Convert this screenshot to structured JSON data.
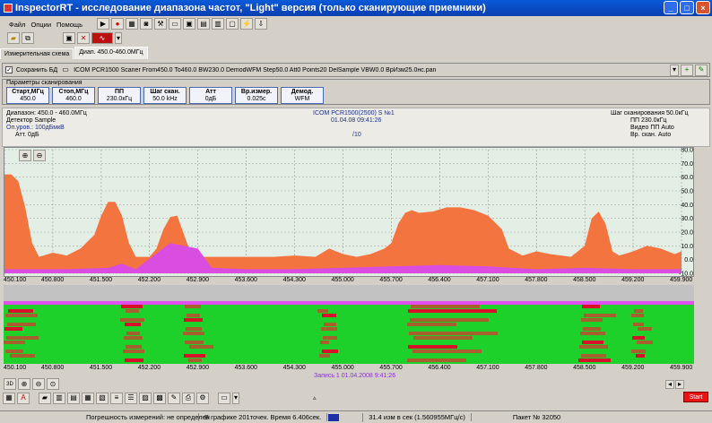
{
  "window": {
    "title": "InspectorRT - исследование диапазона частот, \"Light\" версия (только сканирующие приемники)"
  },
  "menu": [
    "Файл",
    "Опции",
    "Помощь"
  ],
  "tabs": [
    "Измерительная схема",
    "Диап. 450.0-460.0МГц"
  ],
  "scan": {
    "save_label": "Сохранить БД",
    "command": "ICOM PCR1500 Scaner From450.0 To460.0 BW230.0 DemodWFM Step50.0 Att0 Points20 DelSample VBW0.0 ВрИзм25.0нс.pan"
  },
  "params": {
    "title": "Параметры сканирования",
    "items": [
      {
        "label": "Старт,МГц",
        "value": "450.0"
      },
      {
        "label": "Стоп,МГц",
        "value": "460.0"
      },
      {
        "label": "ПП",
        "value": "230.0кГц"
      },
      {
        "label": "Шаг скан.",
        "value": "50.0 kHz"
      },
      {
        "label": "Атт",
        "value": "0дБ"
      },
      {
        "label": "Вр.измер.",
        "value": "0.025с"
      },
      {
        "label": "Демод.",
        "value": "WFM"
      }
    ]
  },
  "info": {
    "range": "Диапазон: 450.0 - 460.0МГц",
    "detector": "Детектор  Sample",
    "ref_level": "Оп.уров.: 100дБмкВ",
    "att": "Атт.  0дБ",
    "device": "ICOM PCR1500(2500) S №1",
    "datetime": "01.04.08 09:41:26",
    "scale": "/10",
    "step": "Шаг сканирования  50.0кГц",
    "bw": "ПП   230.0кГц",
    "video_bw": "Видео ПП  Auto",
    "scan_time": "Вр. скан.  Auto"
  },
  "chart_data": {
    "type": "area",
    "xlabel": "",
    "ylabel": "",
    "xlim": [
      450.1,
      459.9
    ],
    "ylim": [
      -10,
      80
    ],
    "x_ticks": [
      "450.100",
      "450.800",
      "451.500",
      "452.200",
      "452.900",
      "453.600",
      "454.300",
      "455.000",
      "455.700",
      "456.400",
      "457.100",
      "457.800",
      "458.500",
      "459.200",
      "459.900"
    ],
    "y_ticks": [
      "80.0",
      "70.0",
      "60.0",
      "50.0",
      "40.0",
      "30.0",
      "20.0",
      "10.0",
      "0.0",
      "-10.0"
    ],
    "series": [
      {
        "color": "#f4743f",
        "x": [
          450.1,
          450.2,
          450.3,
          450.4,
          450.5,
          450.6,
          450.8,
          451.0,
          451.2,
          451.4,
          451.5,
          451.6,
          451.7,
          451.8,
          451.9,
          452.0,
          452.2,
          452.3,
          452.4,
          452.5,
          452.6,
          452.7,
          452.8,
          452.9,
          453.0,
          453.2,
          453.6,
          454.0,
          454.3,
          454.6,
          454.8,
          455.0,
          455.2,
          455.4,
          455.6,
          455.7,
          455.8,
          455.9,
          456.0,
          456.1,
          456.3,
          456.5,
          456.7,
          456.9,
          457.1,
          457.3,
          457.4,
          457.6,
          457.8,
          458.0,
          458.3,
          458.5,
          458.6,
          458.7,
          458.8,
          458.9,
          459.0,
          459.2,
          459.4,
          459.6,
          459.8,
          459.9
        ],
        "y": [
          62,
          62,
          57,
          38,
          12,
          2,
          5,
          3,
          8,
          18,
          32,
          42,
          42,
          32,
          12,
          2,
          2,
          8,
          22,
          31,
          32,
          18,
          4,
          2,
          2,
          2,
          2,
          2,
          3,
          2,
          8,
          4,
          2,
          4,
          8,
          12,
          26,
          34,
          36,
          34,
          35,
          38,
          38,
          36,
          32,
          22,
          8,
          3,
          6,
          4,
          2,
          10,
          30,
          35,
          26,
          6,
          3,
          6,
          10,
          8,
          4,
          6
        ]
      },
      {
        "color": "#d94ee0",
        "x": [
          450.1,
          450.5,
          451.0,
          451.6,
          451.8,
          452.0,
          452.5,
          452.9,
          453.1,
          453.6,
          454.3,
          455.0,
          455.7,
          456.4,
          457.1,
          457.8,
          458.5,
          459.2,
          459.9
        ],
        "y": [
          -7,
          -7,
          -7,
          -6,
          -3,
          -7,
          12,
          8,
          -6,
          -7,
          -7,
          -6,
          -5,
          -4,
          -5,
          -7,
          -6,
          -7,
          -7
        ]
      }
    ]
  },
  "waterfall": {
    "caption": "Запись 1  01.04.2008 9:41:26"
  },
  "bottom": {
    "start_label": "Start"
  },
  "status": {
    "error": "Погрешность измерений: не определен",
    "points": "В графике 201точек. Время 6.406сек.",
    "rate": "31.4 изм в сек (1.560955МГц/с)",
    "packet": "Пакет № 32050"
  }
}
